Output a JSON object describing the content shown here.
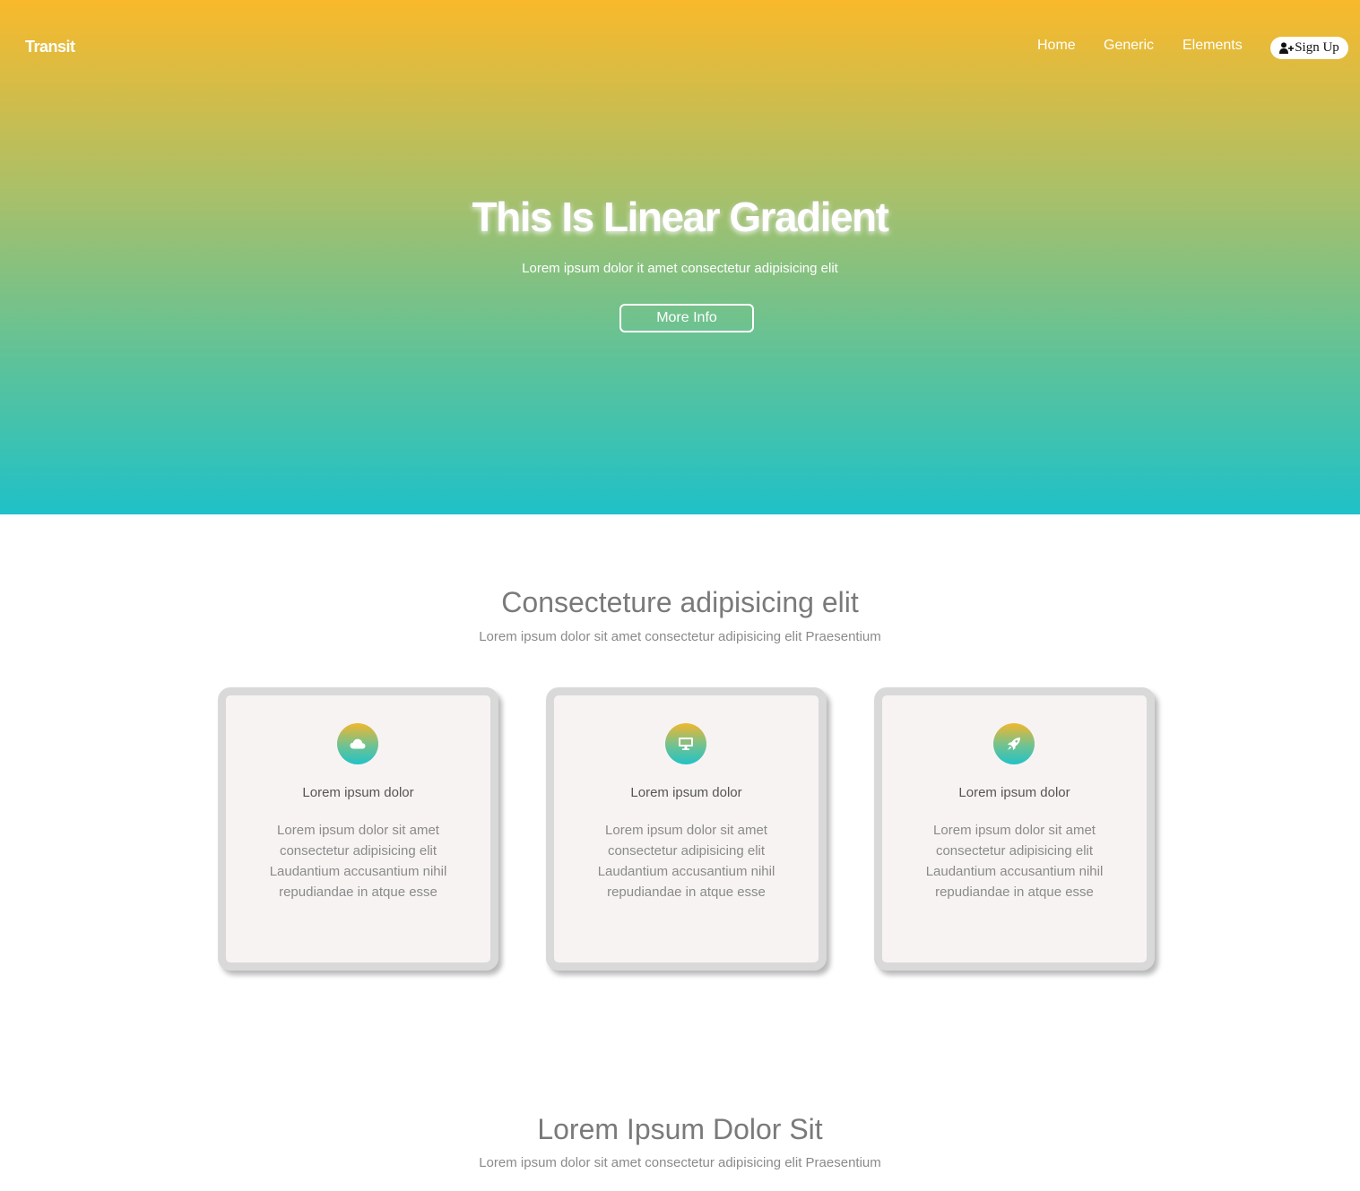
{
  "header": {
    "logo": "Transit",
    "nav": [
      "Home",
      "Generic",
      "Elements"
    ],
    "signup_label": "Sign Up"
  },
  "hero": {
    "title": "This Is Linear Gradient",
    "subtitle": "Lorem ipsum dolor it amet consectetur adipisicing elit",
    "button_label": "More Info",
    "gradient_colors": [
      "#f9b92b",
      "#a8c06a",
      "#5ec299",
      "#1fc1c8"
    ]
  },
  "section1": {
    "title": "Consecteture adipisicing elit",
    "subtitle": "Lorem ipsum dolor sit amet consectetur adipisicing elit Praesentium"
  },
  "cards": [
    {
      "icon": "cloud-icon",
      "title": "Lorem ipsum dolor",
      "text": "Lorem ipsum dolor sit amet consectetur adipisicing elit Laudantium accusantium nihil repudiandae in atque esse"
    },
    {
      "icon": "desktop-icon",
      "title": "Lorem ipsum dolor",
      "text": "Lorem ipsum dolor sit amet consectetur adipisicing elit Laudantium accusantium nihil repudiandae in atque esse"
    },
    {
      "icon": "rocket-icon",
      "title": "Lorem ipsum dolor",
      "text": "Lorem ipsum dolor sit amet consectetur adipisicing elit Laudantium accusantium nihil repudiandae in atque esse"
    }
  ],
  "section2": {
    "title": "Lorem Ipsum Dolor Sit",
    "subtitle": "Lorem ipsum dolor sit amet consectetur adipisicing elit Praesentium"
  }
}
